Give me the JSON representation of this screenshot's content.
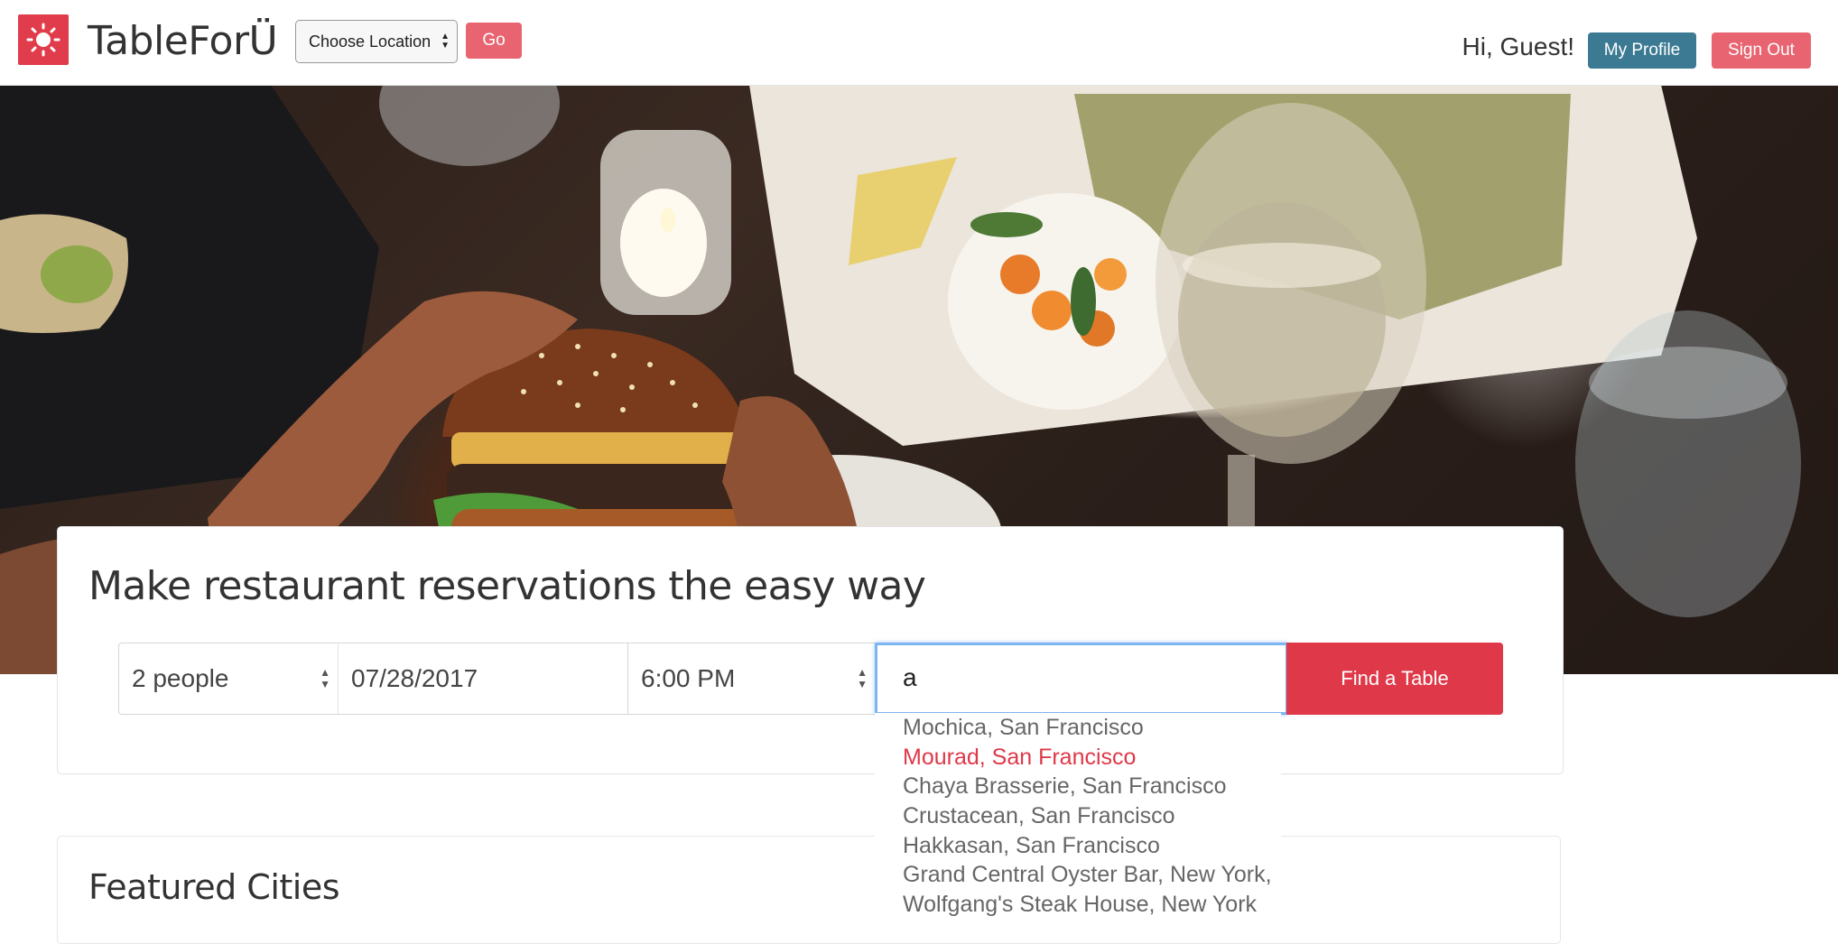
{
  "nav": {
    "brand": "TableForÜ",
    "location_select": {
      "value": "Choose Location"
    },
    "go_label": "Go",
    "greeting": "Hi, Guest!",
    "profile_label": "My Profile",
    "signout_label": "Sign Out"
  },
  "hero": {
    "image": "restaurant table with burger, wine glass, plated dishes and candle"
  },
  "search": {
    "title": "Make restaurant reservations the easy way",
    "party_size": "2 people",
    "date": "07/28/2017",
    "time": "6:00 PM",
    "query": "a",
    "find_label": "Find a Table",
    "suggestions": [
      "Mochica, San Francisco",
      "Mourad, San Francisco",
      "Chaya Brasserie, San Francisco",
      "Crustacean, San Francisco",
      "Hakkasan, San Francisco",
      "Grand Central Oyster Bar, New York,",
      "Wolfgang's Steak House, New York"
    ],
    "active_suggestion_index": 1
  },
  "featured": {
    "title": "Featured Cities"
  },
  "colors": {
    "brand_red": "#df3848",
    "button_pink": "#e86471",
    "profile_blue": "#3c7a93",
    "focus_blue": "#7db5f0"
  }
}
